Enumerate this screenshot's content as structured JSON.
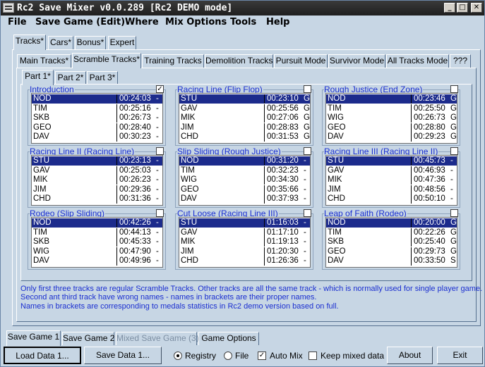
{
  "window": {
    "title": "Rc2 Save Mixer v0.0.289 [Rc2 DEMO mode]",
    "min_icon": "minimize-icon",
    "max_icon": "maximize-icon",
    "close_icon": "close-icon",
    "min_glyph": "_",
    "max_glyph": "□",
    "close_glyph": "✕"
  },
  "menu": [
    "File",
    "Save Game (Edit)",
    "Where",
    "Mix Options",
    "Tools",
    "Help"
  ],
  "top_tabs": [
    "Tracks*",
    "Cars*",
    "Bonus*",
    "Expert"
  ],
  "track_tabs": [
    "Main Tracks*",
    "Scramble Tracks*",
    "Training Tracks",
    "Demolition Tracks",
    "Pursuit Mode",
    "Survivor Mode",
    "All Tracks Mode",
    "???"
  ],
  "part_tabs": [
    "Part 1*",
    "Part 2*",
    "Part 3*"
  ],
  "groups": [
    {
      "label": "Introduction",
      "checked": true,
      "rows": [
        [
          "NOD",
          "00:24:03",
          "-"
        ],
        [
          "TIM",
          "00:25:16",
          "-"
        ],
        [
          "SKB",
          "00:26:73",
          "-"
        ],
        [
          "GEO",
          "00:28:40",
          "-"
        ],
        [
          "DAV",
          "00:30:23",
          "-"
        ]
      ]
    },
    {
      "label": "Racing Line (Flip Flop)",
      "checked": false,
      "rows": [
        [
          "STU",
          "00:23:10",
          "G"
        ],
        [
          "GAV",
          "00:25:56",
          "G"
        ],
        [
          "MIK",
          "00:27:06",
          "G"
        ],
        [
          "JIM",
          "00:28:83",
          "G"
        ],
        [
          "CHD",
          "00:31:53",
          "G"
        ]
      ]
    },
    {
      "label": "Rough Justice (End Zone)",
      "checked": false,
      "rows": [
        [
          "NOD",
          "00:23:46",
          "G"
        ],
        [
          "TIM",
          "00:25:50",
          "G"
        ],
        [
          "WIG",
          "00:26:73",
          "G"
        ],
        [
          "GEO",
          "00:28:80",
          "G"
        ],
        [
          "DAV",
          "00:29:23",
          "G"
        ]
      ]
    },
    {
      "label": "Racing Line II (Racing Line)",
      "checked": false,
      "rows": [
        [
          "STU",
          "00:23:13",
          "-"
        ],
        [
          "GAV",
          "00:25:03",
          "-"
        ],
        [
          "MIK",
          "00:26:23",
          "-"
        ],
        [
          "JIM",
          "00:29:36",
          "-"
        ],
        [
          "CHD",
          "00:31:36",
          "-"
        ]
      ]
    },
    {
      "label": "Slip Sliding (Rough Justice)",
      "checked": false,
      "rows": [
        [
          "NOD",
          "00:31:20",
          "-"
        ],
        [
          "TIM",
          "00:32:23",
          "-"
        ],
        [
          "WIG",
          "00:34:30",
          "-"
        ],
        [
          "GEO",
          "00:35:66",
          "-"
        ],
        [
          "DAV",
          "00:37:93",
          "-"
        ]
      ]
    },
    {
      "label": "Racing Line III (Racing Line II)",
      "checked": false,
      "rows": [
        [
          "STU",
          "00:45:73",
          "-"
        ],
        [
          "GAV",
          "00:46:93",
          "-"
        ],
        [
          "MIK",
          "00:47:36",
          "-"
        ],
        [
          "JIM",
          "00:48:56",
          "-"
        ],
        [
          "CHD",
          "00:50:10",
          "-"
        ]
      ]
    },
    {
      "label": "Rodeo (Slip Sliding)",
      "checked": false,
      "rows": [
        [
          "NOD",
          "00:42:26",
          "-"
        ],
        [
          "TIM",
          "00:44:13",
          "-"
        ],
        [
          "SKB",
          "00:45:33",
          "-"
        ],
        [
          "WIG",
          "00:47:90",
          "-"
        ],
        [
          "DAV",
          "00:49:96",
          "-"
        ]
      ]
    },
    {
      "label": "Cut Loose (Racing Line III)",
      "checked": false,
      "rows": [
        [
          "STU",
          "01:16:03",
          "-"
        ],
        [
          "GAV",
          "01:17:10",
          "-"
        ],
        [
          "MIK",
          "01:19:13",
          "-"
        ],
        [
          "JIM",
          "01:20:30",
          "-"
        ],
        [
          "CHD",
          "01:26:36",
          "-"
        ]
      ]
    },
    {
      "label": "Leap of Faith (Rodeo)",
      "checked": false,
      "rows": [
        [
          "NOD",
          "00:20:00",
          "G"
        ],
        [
          "TIM",
          "00:22:26",
          "G"
        ],
        [
          "SKB",
          "00:25:40",
          "G"
        ],
        [
          "GEO",
          "00:29:73",
          "G"
        ],
        [
          "DAV",
          "00:33:50",
          "S"
        ]
      ]
    }
  ],
  "notes": [
    "Only first three tracks are regular Scramble Tracks. Other tracks are all the same track - which is normally used for single player game.",
    "Second ant third track have wrong names - names in brackets are their proper names.",
    "Names in brackets are corresponding to medals statistics in Rc2 demo version based on full."
  ],
  "bottom_tabs": [
    "Save Game 1",
    "Save Game 2",
    "Mixed Save Game (3)",
    "Game Options"
  ],
  "buttons": {
    "load": "Load Data 1...",
    "save": "Save Data 1...",
    "about": "About",
    "exit": "Exit"
  },
  "options": {
    "registry": "Registry",
    "file": "File",
    "auto_mix": "Auto Mix",
    "keep_mixed": "Keep mixed data",
    "registry_selected": true,
    "auto_mix_checked": true,
    "keep_mixed_checked": false,
    "check_glyph": "✓"
  }
}
